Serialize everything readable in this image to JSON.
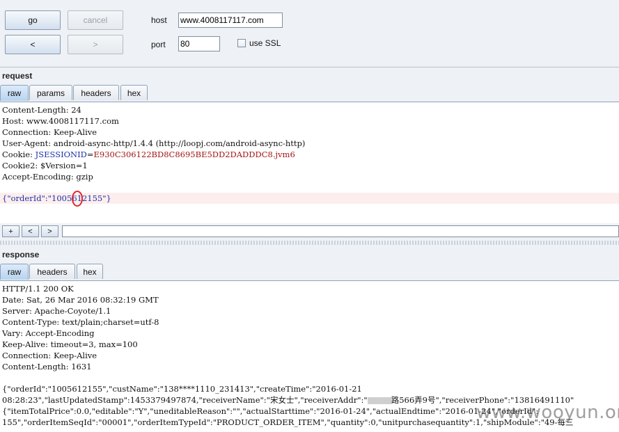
{
  "controls": {
    "go_label": "go",
    "cancel_label": "cancel",
    "back_label": "<",
    "forward_label": ">",
    "host_label": "host",
    "host_value": "www.4008117117.com",
    "port_label": "port",
    "port_value": "80",
    "ssl_label": "use SSL"
  },
  "request": {
    "title": "request",
    "tabs": [
      "raw",
      "params",
      "headers",
      "hex"
    ],
    "lines": [
      "Content-Length: 24",
      "Host: www.4008117117.com",
      "Connection: Keep-Alive",
      "User-Agent: android-async-http/1.4.4 (http://loopj.com/android-async-http)",
      "Accept-Encoding: gzip"
    ],
    "cookie_label": "Cookie: ",
    "cookie_name": "JSESSIONID",
    "cookie_value": "E930C306122BD8C8695BE5DD2DADDDC8.jvm6",
    "cookie2": "Cookie2: $Version=1",
    "body": "{\"orderId\":\"1005612155\"}"
  },
  "search": {
    "plus": "+",
    "prev": "<",
    "next": ">"
  },
  "response": {
    "title": "response",
    "tabs": [
      "raw",
      "headers",
      "hex"
    ],
    "lines": [
      "HTTP/1.1 200 OK",
      "Date: Sat, 26 Mar 2016 08:32:19 GMT",
      "Server: Apache-Coyote/1.1",
      "Content-Type: text/plain;charset=utf-8",
      "Vary: Accept-Encoding",
      "Keep-Alive: timeout=3, max=100",
      "Connection: Keep-Alive",
      "Content-Length: 1631"
    ],
    "body_lines": [
      "{\"orderId\":\"1005612155\",\"custName\":\"138****1110_231413\",\"createTime\":\"2016-01-21",
      "08:28:23\",\"lastUpdatedStamp\":1453379497874,\"receiverName\":\"宋女士\",\"receiverAddr\":\"",
      "路566弄9号\",\"receiverPhone\":\"13816491110\"",
      "{\"itemTotalPrice\":0.0,\"editable\":\"Y\",\"uneditableReason\":\"\",\"actualStarttime\":\"2016-01-24\",\"actualEndtime\":\"2016-01-24\",\"orderId\":",
      "155\",\"orderItemSeqId\":\"00001\",\"orderItemTypeId\":\"PRODUCT_ORDER_ITEM\",\"quantity\":0,\"unitpurchasequantity\":1,\"shipModule\":\"49-每三"
    ]
  },
  "watermark": "www.wooyun.org"
}
